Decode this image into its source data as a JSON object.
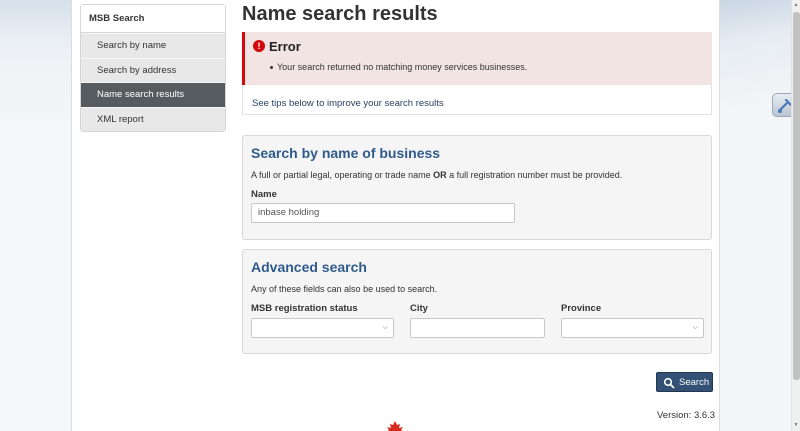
{
  "sidebar": {
    "heading": "MSB Search",
    "items": [
      {
        "label": "Search by name"
      },
      {
        "label": "Search by address"
      },
      {
        "label": "Name search results",
        "active": true
      },
      {
        "label": "XML report"
      }
    ]
  },
  "page": {
    "title": "Name search results"
  },
  "error": {
    "title": "Error",
    "message": "Your search returned no matching money services businesses.",
    "icon": "exclamation-circle-icon",
    "color": "#d3080c"
  },
  "tips": {
    "link": "See tips below to improve your search results"
  },
  "name_search": {
    "title": "Search by name of business",
    "desc_part1": "A full or partial legal, operating or trade name",
    "desc_bold": "OR",
    "desc_part2": "a full registration number must be provided.",
    "name_label": "Name",
    "name_value": "inbase holding"
  },
  "advanced": {
    "title": "Advanced search",
    "desc": "Any of these fields can also be used to search.",
    "status_label": "MSB registration status",
    "status_value": "",
    "city_label": "City",
    "city_value": "",
    "province_label": "Province",
    "province_value": ""
  },
  "actions": {
    "search_label": "Search",
    "search_icon": "magnifier-icon",
    "button_color": "#335075"
  },
  "footer": {
    "version": "Version: 3.6.3"
  },
  "colors": {
    "link": "#284162",
    "heading": "#2f5b8c",
    "active_nav": "#555b5f"
  }
}
